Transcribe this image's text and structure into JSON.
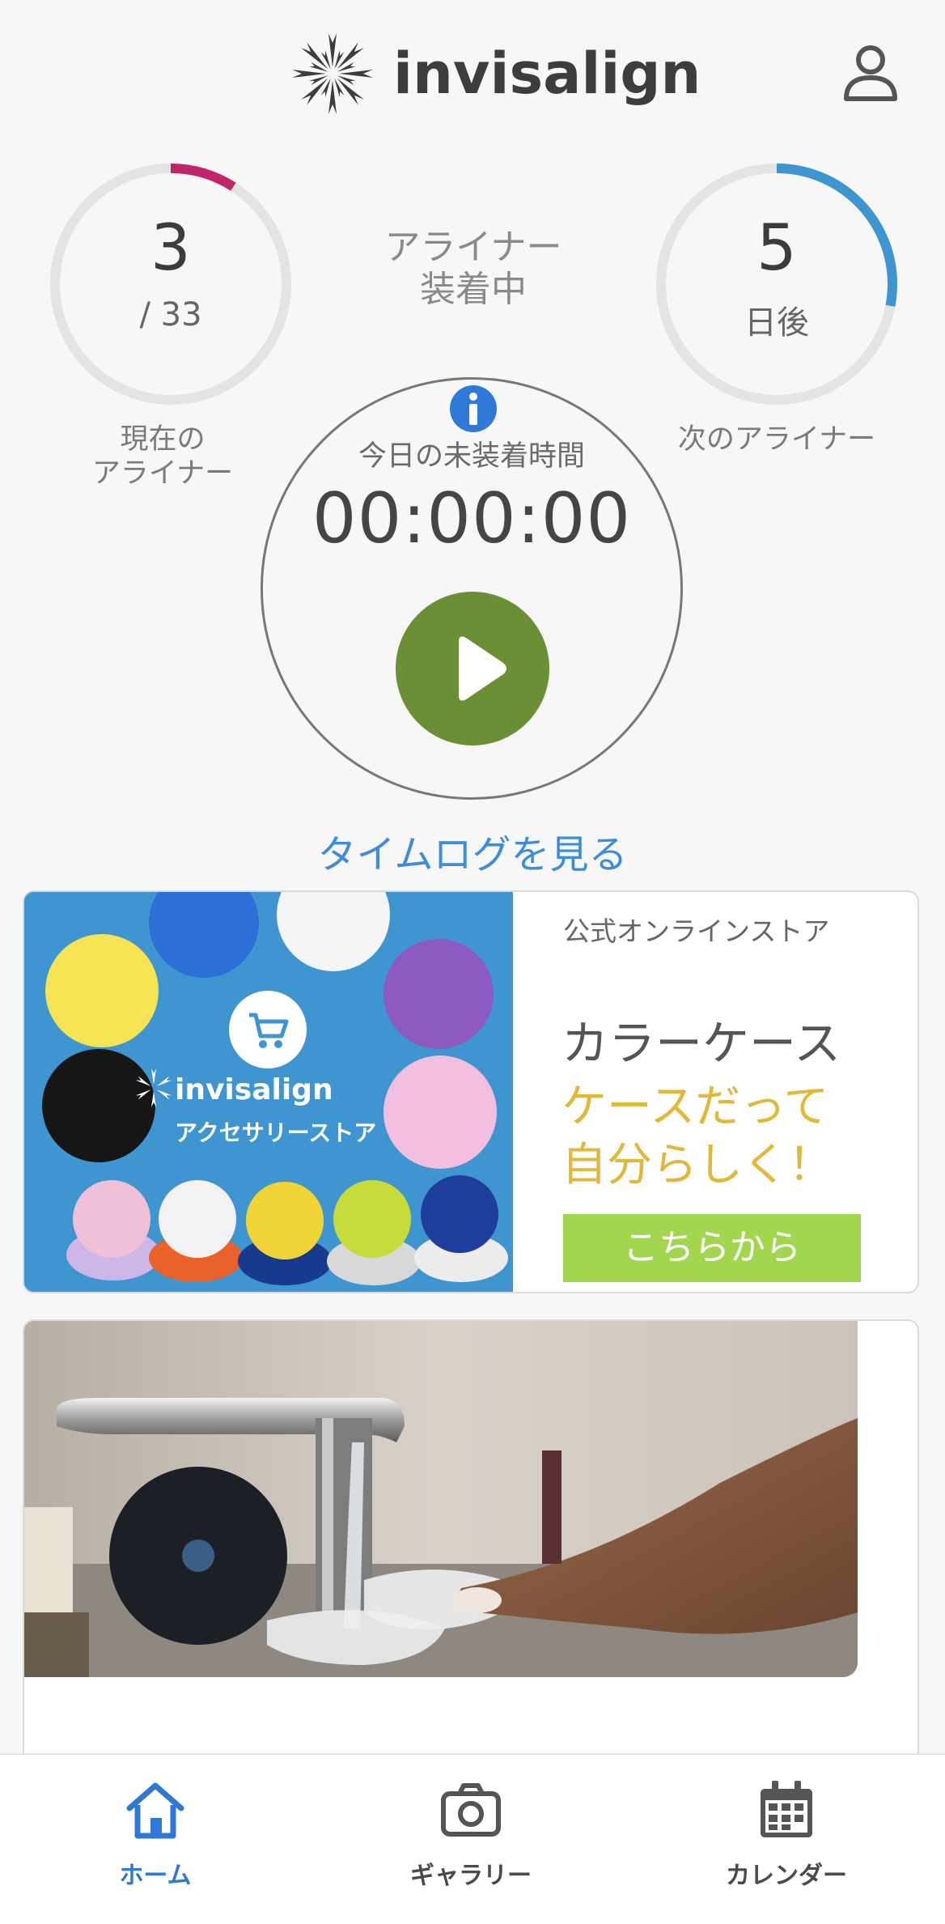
{
  "header": {
    "brand": "invisalign",
    "profile_icon": "user-profile-icon"
  },
  "current_aligner": {
    "number": "3",
    "total": "/ 33",
    "progress": 0.0909,
    "caption_line1": "現在の",
    "caption_line2": "アライナー",
    "ring_color": "#c0246a"
  },
  "status": {
    "line1": "アライナー",
    "line2": "装着中"
  },
  "next_aligner": {
    "days": "5",
    "unit": "日後",
    "progress": 0.28,
    "caption": "次のアライナー",
    "ring_color": "#3e95cf"
  },
  "timer": {
    "info_icon": "info-icon",
    "label": "今日の未装着時間",
    "value": "00:00:00",
    "play_icon": "play-icon",
    "play_color": "#6a8f35"
  },
  "timelog_link": "タイムログを見る",
  "store_card": {
    "image_brand": "invisalign",
    "image_subtitle": "アクセサリーストア",
    "kicker": "公式オンラインストア",
    "title": "カラーケース",
    "tagline_line1": "ケースだって",
    "tagline_line2": "自分らしく！",
    "cta": "こちらから",
    "cta_color": "#a2d64f",
    "tagline_color": "#e2b83a"
  },
  "bottom_nav": {
    "items": [
      {
        "label": "ホーム",
        "icon": "home-icon",
        "active": true
      },
      {
        "label": "ギャラリー",
        "icon": "camera-icon",
        "active": false
      },
      {
        "label": "カレンダー",
        "icon": "calendar-icon",
        "active": false
      }
    ],
    "active_color": "#2f78d6"
  }
}
